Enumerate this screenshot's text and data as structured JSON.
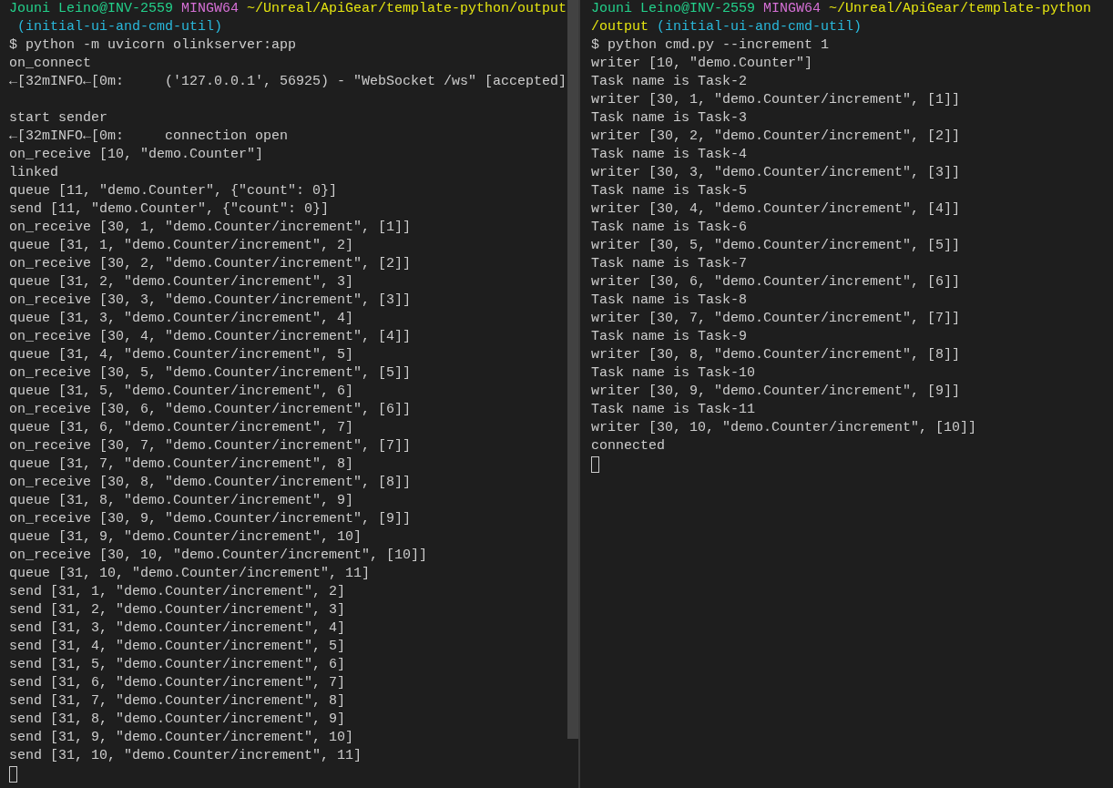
{
  "panes": [
    {
      "scrollbar": true,
      "cursor_visible": true,
      "lines": [
        {
          "segments": [
            {
              "kind": "user",
              "text": "Jouni Leino@INV-2559"
            },
            {
              "kind": "shell",
              "text": " MINGW64"
            },
            {
              "kind": "path",
              "text": " ~/Unreal/ApiGear/template-python/output"
            }
          ]
        },
        {
          "segments": [
            {
              "kind": "branch",
              "text": " (initial-ui-and-cmd-util)"
            }
          ]
        },
        {
          "text": "$ python -m uvicorn olinkserver:app"
        },
        {
          "text": "on_connect"
        },
        {
          "text": "←[32mINFO←[0m:     ('127.0.0.1', 56925) - \"WebSocket /ws\" [accepted]",
          "blank_after": true
        },
        {
          "text": "start sender"
        },
        {
          "text": "←[32mINFO←[0m:     connection open"
        },
        {
          "text": "on_receive [10, \"demo.Counter\"]"
        },
        {
          "text": "linked"
        },
        {
          "text": "queue [11, \"demo.Counter\", {\"count\": 0}]"
        },
        {
          "text": "send [11, \"demo.Counter\", {\"count\": 0}]"
        },
        {
          "text": "on_receive [30, 1, \"demo.Counter/increment\", [1]]"
        },
        {
          "text": "queue [31, 1, \"demo.Counter/increment\", 2]"
        },
        {
          "text": "on_receive [30, 2, \"demo.Counter/increment\", [2]]"
        },
        {
          "text": "queue [31, 2, \"demo.Counter/increment\", 3]"
        },
        {
          "text": "on_receive [30, 3, \"demo.Counter/increment\", [3]]"
        },
        {
          "text": "queue [31, 3, \"demo.Counter/increment\", 4]"
        },
        {
          "text": "on_receive [30, 4, \"demo.Counter/increment\", [4]]"
        },
        {
          "text": "queue [31, 4, \"demo.Counter/increment\", 5]"
        },
        {
          "text": "on_receive [30, 5, \"demo.Counter/increment\", [5]]"
        },
        {
          "text": "queue [31, 5, \"demo.Counter/increment\", 6]"
        },
        {
          "text": "on_receive [30, 6, \"demo.Counter/increment\", [6]]"
        },
        {
          "text": "queue [31, 6, \"demo.Counter/increment\", 7]"
        },
        {
          "text": "on_receive [30, 7, \"demo.Counter/increment\", [7]]"
        },
        {
          "text": "queue [31, 7, \"demo.Counter/increment\", 8]"
        },
        {
          "text": "on_receive [30, 8, \"demo.Counter/increment\", [8]]"
        },
        {
          "text": "queue [31, 8, \"demo.Counter/increment\", 9]"
        },
        {
          "text": "on_receive [30, 9, \"demo.Counter/increment\", [9]]"
        },
        {
          "text": "queue [31, 9, \"demo.Counter/increment\", 10]"
        },
        {
          "text": "on_receive [30, 10, \"demo.Counter/increment\", [10]]"
        },
        {
          "text": "queue [31, 10, \"demo.Counter/increment\", 11]"
        },
        {
          "text": "send [31, 1, \"demo.Counter/increment\", 2]"
        },
        {
          "text": "send [31, 2, \"demo.Counter/increment\", 3]"
        },
        {
          "text": "send [31, 3, \"demo.Counter/increment\", 4]"
        },
        {
          "text": "send [31, 4, \"demo.Counter/increment\", 5]"
        },
        {
          "text": "send [31, 5, \"demo.Counter/increment\", 6]"
        },
        {
          "text": "send [31, 6, \"demo.Counter/increment\", 7]"
        },
        {
          "text": "send [31, 7, \"demo.Counter/increment\", 8]"
        },
        {
          "text": "send [31, 8, \"demo.Counter/increment\", 9]"
        },
        {
          "text": "send [31, 9, \"demo.Counter/increment\", 10]"
        },
        {
          "text": "send [31, 10, \"demo.Counter/increment\", 11]"
        }
      ]
    },
    {
      "cursor_visible": true,
      "lines": [
        {
          "segments": [
            {
              "kind": "user",
              "text": "Jouni Leino@INV-2559"
            },
            {
              "kind": "shell",
              "text": " MINGW64"
            },
            {
              "kind": "path",
              "text": " ~/Unreal/ApiGear/template-python"
            }
          ]
        },
        {
          "segments": [
            {
              "kind": "path",
              "text": "/output"
            },
            {
              "kind": "branch",
              "text": " (initial-ui-and-cmd-util)"
            }
          ]
        },
        {
          "text": "$ python cmd.py --increment 1"
        },
        {
          "text": "writer [10, \"demo.Counter\"]"
        },
        {
          "text": "Task name is Task-2"
        },
        {
          "text": "writer [30, 1, \"demo.Counter/increment\", [1]]"
        },
        {
          "text": "Task name is Task-3"
        },
        {
          "text": "writer [30, 2, \"demo.Counter/increment\", [2]]"
        },
        {
          "text": "Task name is Task-4"
        },
        {
          "text": "writer [30, 3, \"demo.Counter/increment\", [3]]"
        },
        {
          "text": "Task name is Task-5"
        },
        {
          "text": "writer [30, 4, \"demo.Counter/increment\", [4]]"
        },
        {
          "text": "Task name is Task-6"
        },
        {
          "text": "writer [30, 5, \"demo.Counter/increment\", [5]]"
        },
        {
          "text": "Task name is Task-7"
        },
        {
          "text": "writer [30, 6, \"demo.Counter/increment\", [6]]"
        },
        {
          "text": "Task name is Task-8"
        },
        {
          "text": "writer [30, 7, \"demo.Counter/increment\", [7]]"
        },
        {
          "text": "Task name is Task-9"
        },
        {
          "text": "writer [30, 8, \"demo.Counter/increment\", [8]]"
        },
        {
          "text": "Task name is Task-10"
        },
        {
          "text": "writer [30, 9, \"demo.Counter/increment\", [9]]"
        },
        {
          "text": "Task name is Task-11"
        },
        {
          "text": "writer [30, 10, \"demo.Counter/increment\", [10]]"
        },
        {
          "text": "connected"
        }
      ]
    }
  ]
}
